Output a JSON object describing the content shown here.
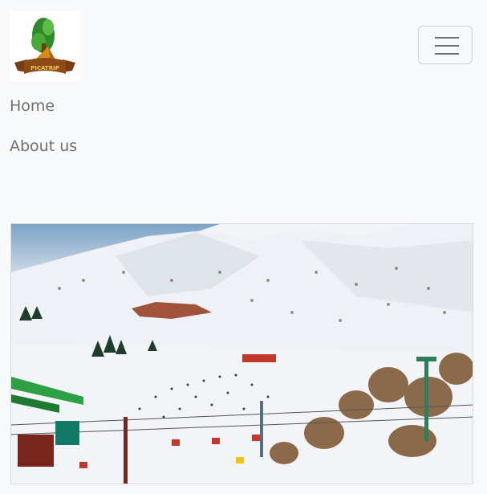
{
  "brand": {
    "logo_label": "PICATRIP"
  },
  "navbar": {
    "toggler_icon": "hamburger-menu-icon",
    "links": [
      "Home",
      "About us"
    ]
  },
  "hero": {
    "image_subject": "snowy ski slope with chairlifts and skiers"
  }
}
